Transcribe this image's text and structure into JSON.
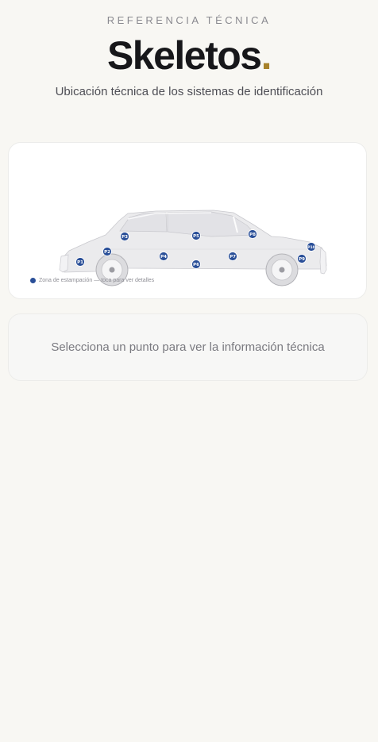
{
  "header": {
    "eyebrow": "REFERENCIA TÉCNICA",
    "brand_name": "Skeletos",
    "brand_dot": ".",
    "subtitle": "Ubicación técnica de los sistemas de identificación"
  },
  "diagram": {
    "legend_text": "Zona de estampación — toca para ver detalles",
    "points": [
      "P1",
      "P2",
      "P3",
      "P4",
      "P5",
      "P6",
      "P7",
      "P8",
      "P9",
      "P10"
    ],
    "point_color": "#2a4f98"
  },
  "info_panel": {
    "placeholder": "Selecciona un punto para ver la información técnica"
  },
  "colors": {
    "accent": "#a7812a",
    "background": "#f8f7f3"
  }
}
